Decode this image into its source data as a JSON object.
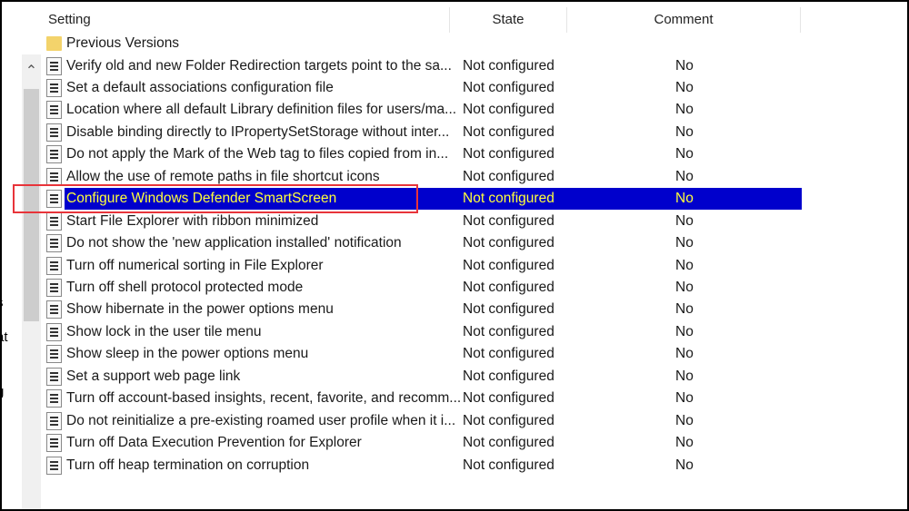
{
  "left_pane_fragments": [
    "s",
    "at",
    "g"
  ],
  "columns": {
    "setting": "Setting",
    "state": "State",
    "comment": "Comment"
  },
  "folder": {
    "name": "Previous Versions"
  },
  "rows": [
    {
      "name": "Verify old and new Folder Redirection targets point to the sa...",
      "state": "Not configured",
      "comment": "No"
    },
    {
      "name": "Set a default associations configuration file",
      "state": "Not configured",
      "comment": "No"
    },
    {
      "name": "Location where all default Library definition files for users/ma...",
      "state": "Not configured",
      "comment": "No"
    },
    {
      "name": "Disable binding directly to IPropertySetStorage without inter...",
      "state": "Not configured",
      "comment": "No"
    },
    {
      "name": "Do not apply the Mark of the Web tag to files copied from in...",
      "state": "Not configured",
      "comment": "No"
    },
    {
      "name": "Allow the use of remote paths in file shortcut icons",
      "state": "Not configured",
      "comment": "No"
    },
    {
      "name": "Configure Windows Defender SmartScreen",
      "state": "Not configured",
      "comment": "No",
      "selected": true
    },
    {
      "name": "Start File Explorer with ribbon minimized",
      "state": "Not configured",
      "comment": "No"
    },
    {
      "name": "Do not show the 'new application installed' notification",
      "state": "Not configured",
      "comment": "No"
    },
    {
      "name": "Turn off numerical sorting in File Explorer",
      "state": "Not configured",
      "comment": "No"
    },
    {
      "name": "Turn off shell protocol protected mode",
      "state": "Not configured",
      "comment": "No"
    },
    {
      "name": "Show hibernate in the power options menu",
      "state": "Not configured",
      "comment": "No"
    },
    {
      "name": "Show lock in the user tile menu",
      "state": "Not configured",
      "comment": "No"
    },
    {
      "name": "Show sleep in the power options menu",
      "state": "Not configured",
      "comment": "No"
    },
    {
      "name": "Set a support web page link",
      "state": "Not configured",
      "comment": "No"
    },
    {
      "name": "Turn off account-based insights, recent, favorite, and recomm...",
      "state": "Not configured",
      "comment": "No"
    },
    {
      "name": "Do not reinitialize a pre-existing roamed user profile when it i...",
      "state": "Not configured",
      "comment": "No"
    },
    {
      "name": "Turn off Data Execution Prevention for Explorer",
      "state": "Not configured",
      "comment": "No"
    },
    {
      "name": "Turn off heap termination on corruption",
      "state": "Not configured",
      "comment": "No"
    }
  ],
  "colors": {
    "selection_bg": "#0000cc",
    "selection_text": "#ffff3c",
    "highlight_box": "#e8343a"
  }
}
